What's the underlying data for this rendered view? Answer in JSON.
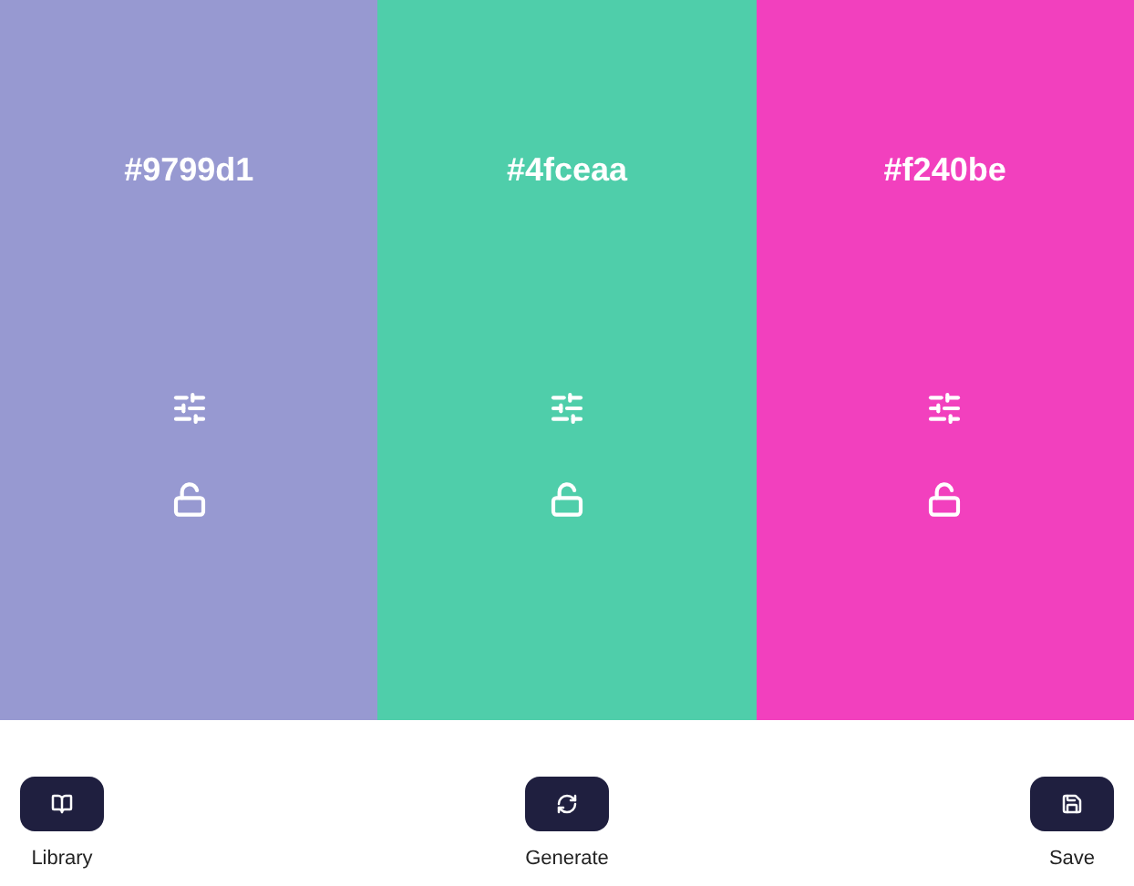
{
  "swatches": [
    {
      "hex": "#9799d1",
      "color": "#9799d1",
      "locked": false
    },
    {
      "hex": "#4fceaa",
      "color": "#4fceaa",
      "locked": false
    },
    {
      "hex": "#f240be",
      "color": "#f240be",
      "locked": false
    }
  ],
  "actions": [
    {
      "kind": "library",
      "label": "Library"
    },
    {
      "kind": "generate",
      "label": "Generate"
    },
    {
      "kind": "save",
      "label": "Save"
    }
  ]
}
